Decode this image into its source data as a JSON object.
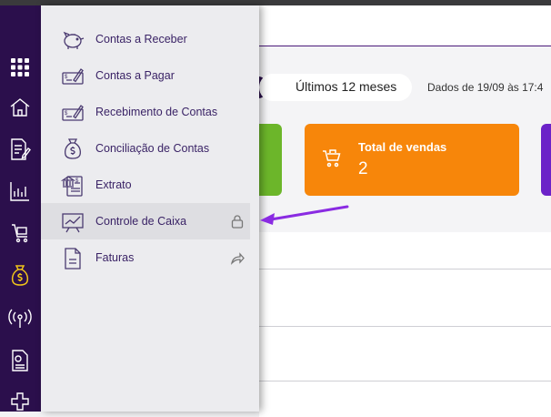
{
  "filter": {
    "period": "Últimos 12 meses",
    "updated": "Dados de 19/09 às 17:4"
  },
  "cards": [
    {
      "title": "Total de vendas",
      "value": "2"
    }
  ],
  "menu": {
    "items": [
      {
        "label": "Contas a Receber",
        "icon": "piggy-bank-icon"
      },
      {
        "label": "Contas a Pagar",
        "icon": "check-pay-icon"
      },
      {
        "label": "Recebimento de Contas",
        "icon": "check-receive-icon"
      },
      {
        "label": "Conciliação de Contas",
        "icon": "money-bag-icon"
      },
      {
        "label": "Extrato",
        "icon": "bank-statement-icon"
      },
      {
        "label": "Controle de Caixa",
        "icon": "chart-board-icon",
        "trail": "lock-icon"
      },
      {
        "label": "Faturas",
        "icon": "document-icon",
        "trail": "share-icon"
      }
    ]
  },
  "sidebar": {
    "icons": [
      "grid-icon",
      "home-icon",
      "edit-document-icon",
      "chart-icon",
      "cart-icon",
      "money-bag-icon",
      "broadcast-icon",
      "report-icon",
      "puzzle-icon"
    ]
  },
  "colors": {
    "sidebar": "#2b0f4c",
    "accent": "#8a2be2",
    "orange": "#f7860a",
    "green": "#6cb62a",
    "purple": "#6b22c8"
  }
}
